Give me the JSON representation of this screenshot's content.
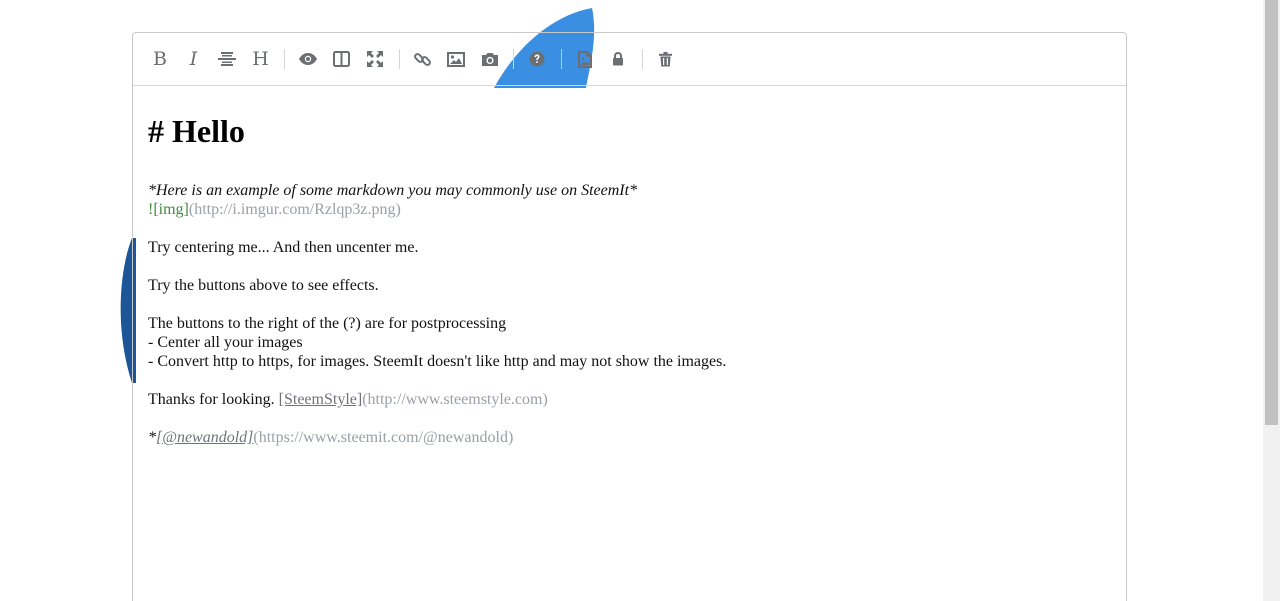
{
  "toolbar": {
    "bold": "B",
    "italic": "I",
    "heading": "H",
    "icons": [
      "bold-icon",
      "italic-icon",
      "strikethrough-icon",
      "heading-icon",
      "eye-icon",
      "side-by-side-icon",
      "fullscreen-icon",
      "link-icon",
      "image-icon",
      "camera-icon",
      "help-icon",
      "center-image-icon",
      "lock-icon",
      "trash-icon"
    ]
  },
  "content": {
    "heading": "# Hello",
    "italic_line": "*Here is an example of some markdown you may commonly use on SteemIt*",
    "img_label": "![img]",
    "img_url": "(http://i.imgur.com/Rzlqp3z.png)",
    "line_center": "Try centering me... And then uncenter me.",
    "line_buttons": "Try the buttons above to see effects.",
    "line_postprocess": "The buttons to the right of the (?) are for postprocessing",
    "bullet_1": "- Center all your images",
    "bullet_2": "- Convert http to https, for images. SteemIt doesn't like http and may not show the images.",
    "thanks_text": "Thanks for looking. ",
    "steemstyle_label": "[SteemStyle]",
    "steemstyle_url": "(http://www.steemstyle.com)",
    "author_prefix": "*",
    "author_label": "[@newandold]",
    "author_url": "(https://www.steemit.com/@newandold)"
  },
  "colors": {
    "accent_blue": "#3b8fe3",
    "deep_blue": "#1c5699",
    "icon_gray": "#6b6f73",
    "url_gray": "#9aa0a6",
    "img_green": "#3d8b3d"
  }
}
